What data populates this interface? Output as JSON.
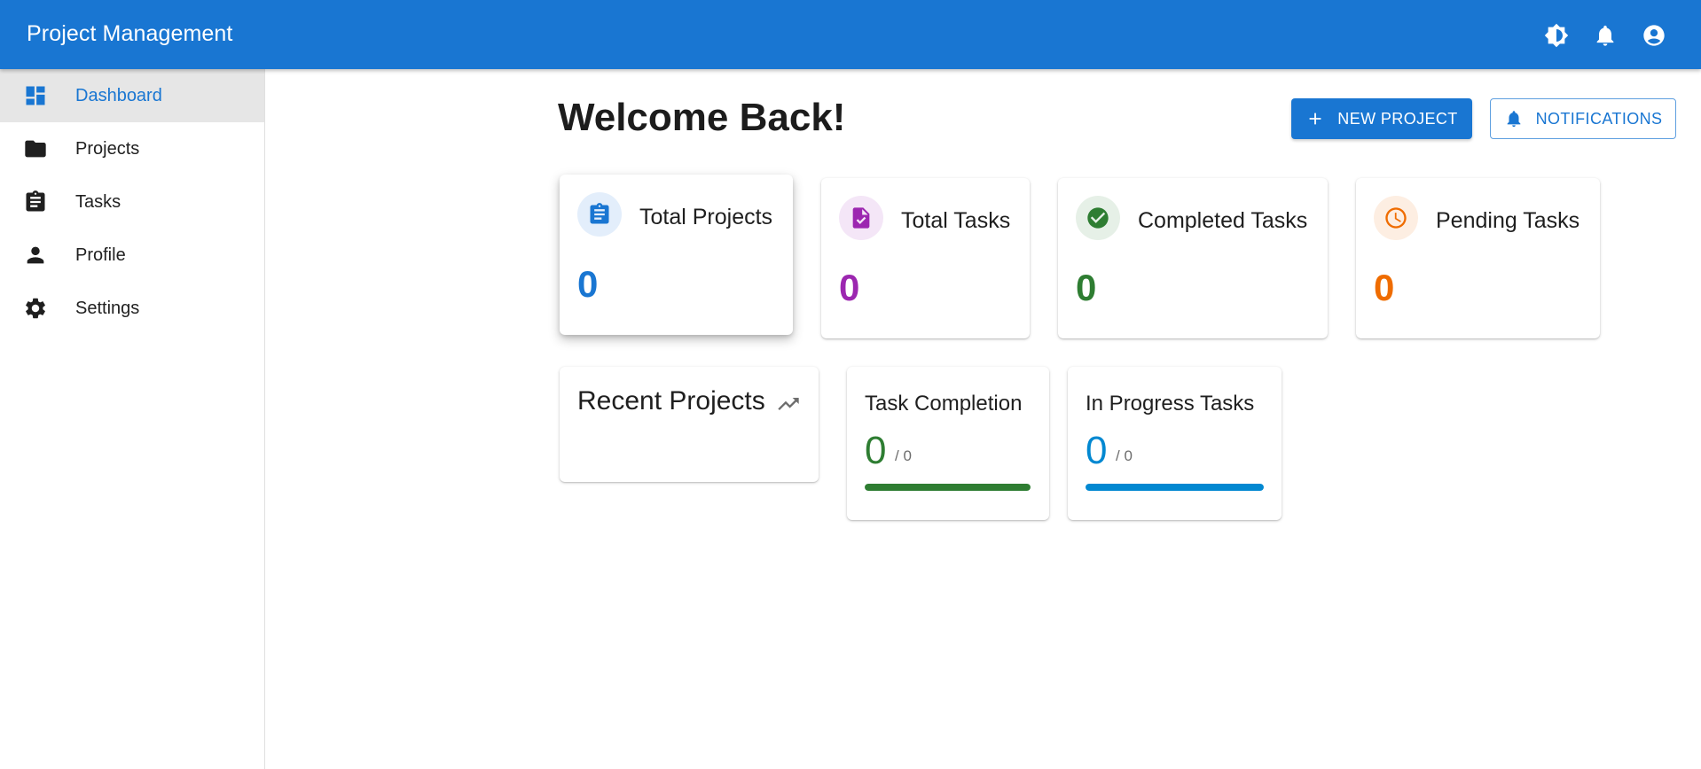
{
  "appbar": {
    "title": "Project Management",
    "icons": [
      "theme-toggle-icon",
      "notifications-bell-icon",
      "account-circle-icon"
    ]
  },
  "sidebar": {
    "items": [
      {
        "label": "Dashboard",
        "icon": "dashboard-icon",
        "active": true
      },
      {
        "label": "Projects",
        "icon": "folder-icon",
        "active": false
      },
      {
        "label": "Tasks",
        "icon": "assignment-icon",
        "active": false
      },
      {
        "label": "Profile",
        "icon": "person-icon",
        "active": false
      },
      {
        "label": "Settings",
        "icon": "gear-icon",
        "active": false
      }
    ]
  },
  "main": {
    "welcome": "Welcome Back!",
    "new_project_label": "NEW PROJECT",
    "notifications_label": "NOTIFICATIONS",
    "stats": [
      {
        "label": "Total Projects",
        "value": "0",
        "icon": "assignment-icon",
        "color": "#1976d2",
        "badge_bg": "#e3eefb"
      },
      {
        "label": "Total Tasks",
        "value": "0",
        "icon": "task-file-icon",
        "color": "#9c27b0",
        "badge_bg": "#f4e6f7"
      },
      {
        "label": "Completed Tasks",
        "value": "0",
        "icon": "check-circle-icon",
        "color": "#2e7d32",
        "badge_bg": "#e6f0e7"
      },
      {
        "label": "Pending Tasks",
        "value": "0",
        "icon": "clock-icon",
        "color": "#ef6c00",
        "badge_bg": "#fdeee2"
      }
    ],
    "recent_projects": {
      "title": "Recent Projects",
      "icon": "trending-up-icon"
    },
    "progress": [
      {
        "label": "Task Completion",
        "value": "0",
        "total": "/ 0",
        "color": "#2e7d32",
        "fill": 1.0
      },
      {
        "label": "In Progress Tasks",
        "value": "0",
        "total": "/ 0",
        "color": "#0288d1",
        "fill": 1.0
      }
    ]
  }
}
